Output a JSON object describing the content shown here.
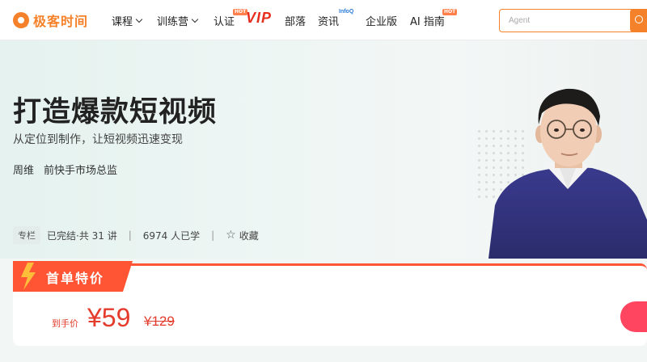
{
  "logo": {
    "text": "极客时间"
  },
  "nav": {
    "courses": "课程",
    "camp": "训练营",
    "cert": "认证",
    "vip": "VIP",
    "tribe": "部落",
    "news": "资讯",
    "enterprise": "企业版",
    "ai": "AI 指南",
    "hot_badge": "HOT",
    "infoq_badge": "InfoQ"
  },
  "search": {
    "placeholder": "Agent",
    "icon": "search-icon"
  },
  "hero": {
    "title": "打造爆款短视频",
    "subtitle": "从定位到制作，让短视频迅速变现",
    "author_name": "周维",
    "author_title": "前快手市场总监",
    "tag": "专栏",
    "status": "已完结·共 31 讲",
    "learners": "6974 人已学",
    "favorite": "收藏",
    "separator": "|"
  },
  "offer": {
    "banner": "首单特价",
    "price_label": "到手价",
    "price": "¥59",
    "original_price": "¥129"
  },
  "colors": {
    "brand": "#f5822a",
    "price": "#e43b2c",
    "banner": "#ff5535"
  }
}
